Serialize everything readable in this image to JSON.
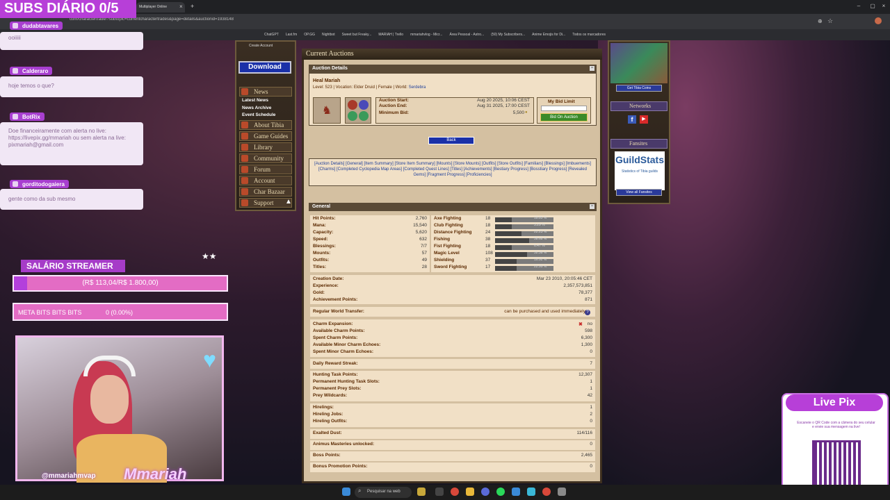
{
  "overlay": {
    "subs_title": "SUBS DIÁRIO 0/5"
  },
  "browser": {
    "tab_title": "Multiplayer Online",
    "url": "com/charactertrade/?subtopic=currentcharactertrades&page=details&auctionid=1938148",
    "bookmarks": [
      "ChatGPT",
      "Last.fm",
      "OP.GG",
      "Nightbot",
      "Sweet but Freaky...",
      "MARIAH | Trello",
      "mmariahvlog - Micr...",
      "Área Pessoal - Astro...",
      "(50) My Subscribers...",
      "Anime Emojis for Di...",
      "Todos os marcadores"
    ]
  },
  "chat": [
    {
      "name": "dudabtavares",
      "message": "ooiiiii"
    },
    {
      "name": "Calderaro",
      "message": "hoje temos o que?"
    },
    {
      "name": "BotRix",
      "message": "Doe financeiramente com alerta no live: https://livepix.gg/mmariah ou sem alerta na live: pixmariah@gmail.com"
    },
    {
      "name": "gorditodogaiera",
      "message": "gente como da sub mesmo"
    }
  ],
  "salario": {
    "title": "SALÁRIO STREAMER",
    "amount": "(R$ 113,04/R$ 1.800,00)",
    "progress": 0.063
  },
  "meta": {
    "label": "META BITS BITS BITS",
    "value": "0 (0.00%)"
  },
  "cam": {
    "handle": "@mmariahmvap",
    "logo": "Mmariah"
  },
  "menu": {
    "create_account": "Create Account",
    "download": "Download",
    "news": "News",
    "news_subs": [
      "Latest News",
      "News Archive",
      "Event Schedule"
    ],
    "items": [
      "About Tibia",
      "Game Guides",
      "Library",
      "Community",
      "Forum",
      "Account",
      "Char Bazaar",
      "Support"
    ]
  },
  "auction": {
    "page_title": "Current Auctions",
    "details_header": "Auction Details",
    "char_name": "Heal Mariah",
    "char_info": "Level: 523 | Vocation: Elder Druid | Female | World: ",
    "world": "Serdebra",
    "start_label": "Auction Start:",
    "start_value": "Aug 20 2025, 10:06 CEST",
    "end_label": "Auction End:",
    "end_value": "Aug 31 2025, 17:00 CEST",
    "min_bid_label": "Minimum Bid:",
    "min_bid_value": "5,500",
    "bid_limit_label": "My Bid Limit",
    "bid_button": "Bid On Auction",
    "back_button": "Back",
    "links": "[Auction Details] [General] [Item Summary] [Store Item Summary] [Mounts] [Store Mounts] [Outfits] [Store Outfits] [Familiars] [Blessings] [Imbuements] [Charms] [Completed Cyclopedia Map Areas] [Completed Quest Lines] [Titles] [Achievements] [Bestiary Progress] [Bosstiary Progress] [Revealed Gems] [Fragment Progress] [Proficiencies]",
    "general_header": "General"
  },
  "general": {
    "stats": [
      {
        "k": "Hit Points:",
        "v": "2,760"
      },
      {
        "k": "Mana:",
        "v": "15,540"
      },
      {
        "k": "Capacity:",
        "v": "5,620"
      },
      {
        "k": "Speed:",
        "v": "632"
      },
      {
        "k": "Blessings:",
        "v": "7/7"
      },
      {
        "k": "Mounts:",
        "v": "57"
      },
      {
        "k": "Outfits:",
        "v": "49"
      },
      {
        "k": "Titles:",
        "v": "28"
      }
    ],
    "skills": [
      {
        "k": "Axe Fighting",
        "n": "18",
        "fill": 0.28,
        "pct": "18.85 %"
      },
      {
        "k": "Club Fighting",
        "n": "18",
        "fill": 0.28,
        "pct": "3.29 %"
      },
      {
        "k": "Distance Fighting",
        "n": "24",
        "fill": 0.45,
        "pct": "22.23 %"
      },
      {
        "k": "Fishing",
        "n": "38",
        "fill": 0.58,
        "pct": "58.68 %"
      },
      {
        "k": "Fist Fighting",
        "n": "18",
        "fill": 0.28,
        "pct": "6.47 %"
      },
      {
        "k": "Magic Level",
        "n": "108",
        "fill": 0.55,
        "pct": "32.38 %"
      },
      {
        "k": "Shielding",
        "n": "37",
        "fill": 0.37,
        "pct": "16.92 %"
      },
      {
        "k": "Sword Fighting",
        "n": "17",
        "fill": 0.37,
        "pct": "22.99 %"
      }
    ],
    "rows": [
      {
        "k": "Creation Date:",
        "v": "Mar 23 2010, 20:05:46 CET"
      },
      {
        "k": "Experience:",
        "v": "2,357,573,851"
      },
      {
        "k": "Gold:",
        "v": "78,377"
      },
      {
        "k": "Achievement Points:",
        "v": "871"
      }
    ],
    "transfer_label": "Regular World Transfer:",
    "transfer_value": "can be purchased and used immediately",
    "charm_rows": [
      {
        "k": "Charm Expansion:",
        "v": "no"
      },
      {
        "k": "Available Charm Points:",
        "v": "598"
      },
      {
        "k": "Spent Charm Points:",
        "v": "6,300"
      },
      {
        "k": "Available Minor Charm Echoes:",
        "v": "1,300"
      },
      {
        "k": "Spent Minor Charm Echoes:",
        "v": "0"
      }
    ],
    "daily_label": "Daily Reward Streak:",
    "daily_value": "7",
    "hunt_rows": [
      {
        "k": "Hunting Task Points:",
        "v": "12,307"
      },
      {
        "k": "Permanent Hunting Task Slots:",
        "v": "1"
      },
      {
        "k": "Permanent Prey Slots:",
        "v": "1"
      },
      {
        "k": "Prey Wildcards:",
        "v": "42"
      }
    ],
    "hire_rows": [
      {
        "k": "Hirelings:",
        "v": "1"
      },
      {
        "k": "Hireling Jobs:",
        "v": "2"
      },
      {
        "k": "Hireling Outfits:",
        "v": "0"
      }
    ],
    "dust_label": "Exalted Dust:",
    "dust_value": "114/116",
    "animus_label": "Animus Masteries unlocked:",
    "animus_value": "0",
    "boss_label": "Boss Points:",
    "boss_value": "2,465",
    "bonus_label": "Bonus Promotion Points:",
    "bonus_value": "0"
  },
  "right": {
    "coins_button": "Get Tibia Coins",
    "networks": "Networks",
    "fansites": "Fansites",
    "guildstats": "GuildStats",
    "guild_sub": "Statistics of Tibia guilds",
    "view_all": "View all Fansites"
  },
  "livepix": {
    "title": "Live Pix",
    "desc": "Escaneie o QR Code com a câmera do seu celular e envie sua mensagem na live!"
  },
  "taskbar": {
    "search": "Pesquisar na web"
  }
}
